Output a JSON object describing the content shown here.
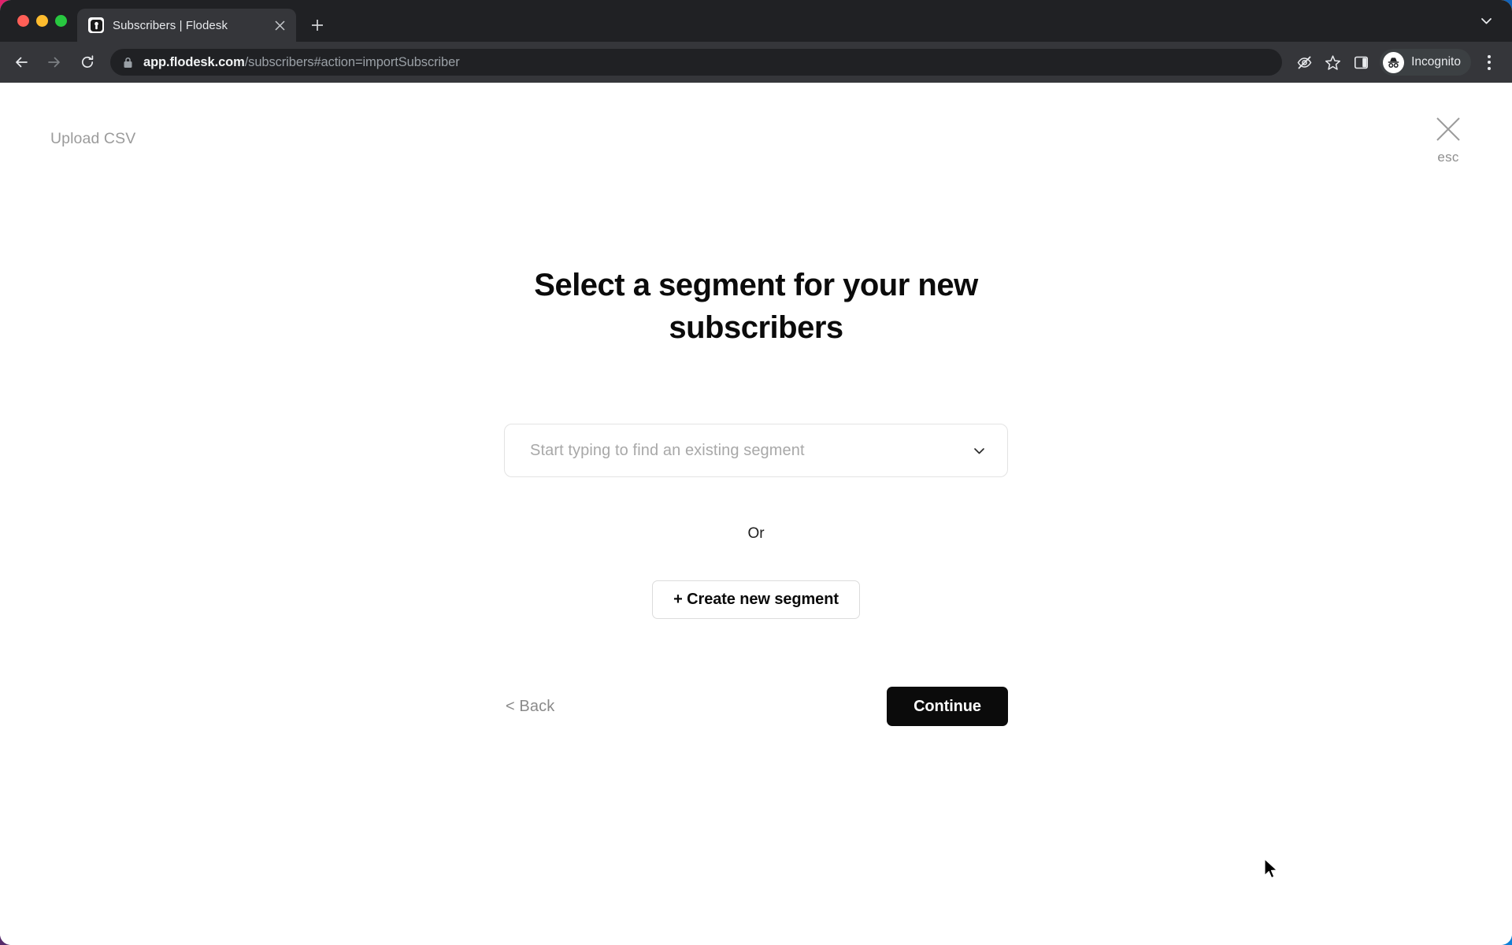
{
  "browser": {
    "tab": {
      "title": "Subscribers | Flodesk",
      "favicon_icon": "flodesk-logo-icon",
      "close_icon": "close-icon"
    },
    "new_tab_icon": "plus-icon",
    "tabstrip_chevron_icon": "chevron-down-icon",
    "toolbar": {
      "back_icon": "arrow-back-icon",
      "forward_icon": "arrow-forward-icon",
      "reload_icon": "reload-icon",
      "lock_icon": "lock-icon",
      "url_host": "app.flodesk.com",
      "url_path": "/subscribers#action=importSubscriber",
      "eye_off_icon": "eye-off-icon",
      "bookmark_icon": "star-icon",
      "side_panel_icon": "side-panel-icon",
      "profile_label": "Incognito",
      "profile_icon": "incognito-icon",
      "menu_icon": "kebab-menu-icon"
    }
  },
  "page": {
    "header_label": "Upload CSV",
    "close": {
      "icon": "close-x-icon",
      "label": "esc"
    },
    "title": "Select a segment for your new subscribers",
    "segment_select": {
      "placeholder": "Start typing to find an existing segment",
      "value": "",
      "chevron_icon": "chevron-down-icon"
    },
    "divider_text": "Or",
    "create_segment_label": "+ Create new segment",
    "back_label": "< Back",
    "continue_label": "Continue"
  },
  "colors": {
    "accent": "#0b0b0b",
    "browser_chrome": "#35363a",
    "tabstrip": "#202124",
    "muted_text": "#9b9b9b"
  }
}
